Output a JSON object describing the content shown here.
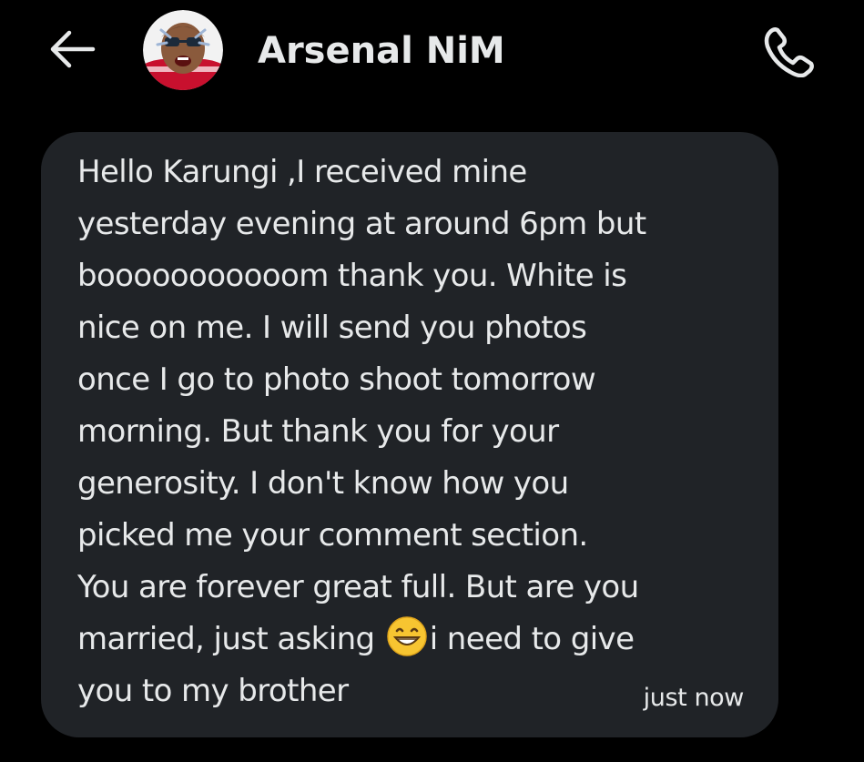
{
  "header": {
    "back_icon": "arrow-left-icon",
    "contact_name": "Arsenal NiM",
    "call_icon": "phone-icon"
  },
  "message": {
    "lines": [
      "Hello Karungi ,I received mine",
      "yesterday evening at around 6pm but",
      "booooooooooom thank you.  White is",
      "nice on me.  I will send you photos",
      "once I go to photo shoot tomorrow",
      "morning.  But thank you for your",
      "generosity.  I don't know how you",
      "picked me your comment section.",
      "You are forever great full. But are you",
      "married, just asking ",
      "i need to give",
      "you to my brother"
    ],
    "emoji": "grinning-face-icon",
    "timestamp": "just now"
  },
  "colors": {
    "background": "#000000",
    "bubble": "#202327",
    "text": "#e7e9ea"
  }
}
